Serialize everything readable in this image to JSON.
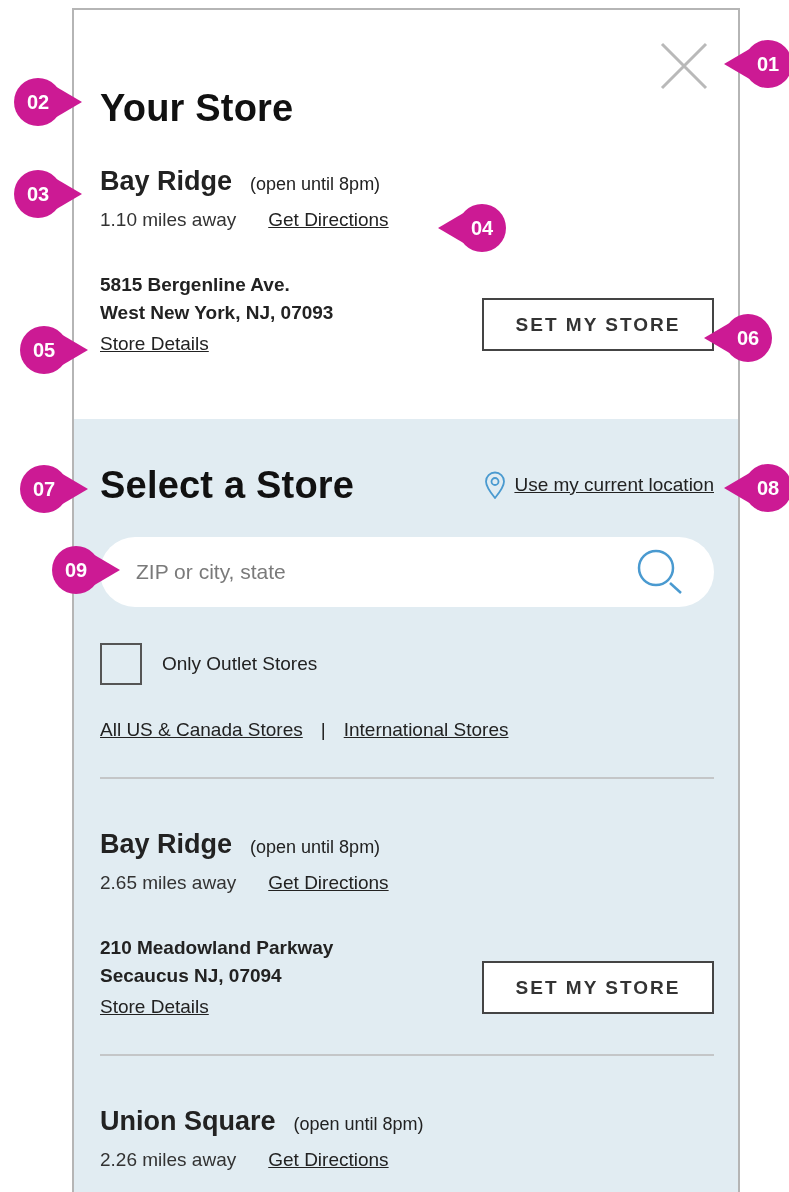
{
  "your_store": {
    "title": "Your Store",
    "store": {
      "name": "Bay Ridge",
      "hours": "(open until 8pm)",
      "distance": "1.10 miles away",
      "directions": "Get Directions",
      "address": [
        "5815 Bergenline Ave.",
        "West New York, NJ, 07093"
      ],
      "details": "Store Details",
      "button": "SET MY STORE"
    }
  },
  "select_store": {
    "title": "Select a Store",
    "location_link": "Use my current location",
    "search": {
      "placeholder": "ZIP or city, state"
    },
    "outlet_filter": {
      "label": "Only Outlet Stores",
      "checked": false
    },
    "links": [
      "All US & Canada Stores",
      "International Stores"
    ],
    "link_separator": "|",
    "stores": [
      {
        "name": "Bay Ridge",
        "hours": "(open until 8pm)",
        "distance": "2.65 miles away",
        "directions": "Get Directions",
        "address": [
          "210 Meadowland Parkway",
          "Secaucus NJ, 07094"
        ],
        "details": "Store Details",
        "button": "SET MY STORE"
      },
      {
        "name": "Union Square",
        "hours": "(open until 8pm)",
        "distance": "2.26 miles away",
        "directions": "Get Directions"
      }
    ]
  },
  "annotations": [
    {
      "label": "01",
      "kind": "left"
    },
    {
      "label": "02",
      "kind": "right"
    },
    {
      "label": "03",
      "kind": "right"
    },
    {
      "label": "04",
      "kind": "left"
    },
    {
      "label": "05",
      "kind": "right"
    },
    {
      "label": "06",
      "kind": "left"
    },
    {
      "label": "07",
      "kind": "right"
    },
    {
      "label": "08",
      "kind": "left"
    },
    {
      "label": "09",
      "kind": "right"
    }
  ]
}
